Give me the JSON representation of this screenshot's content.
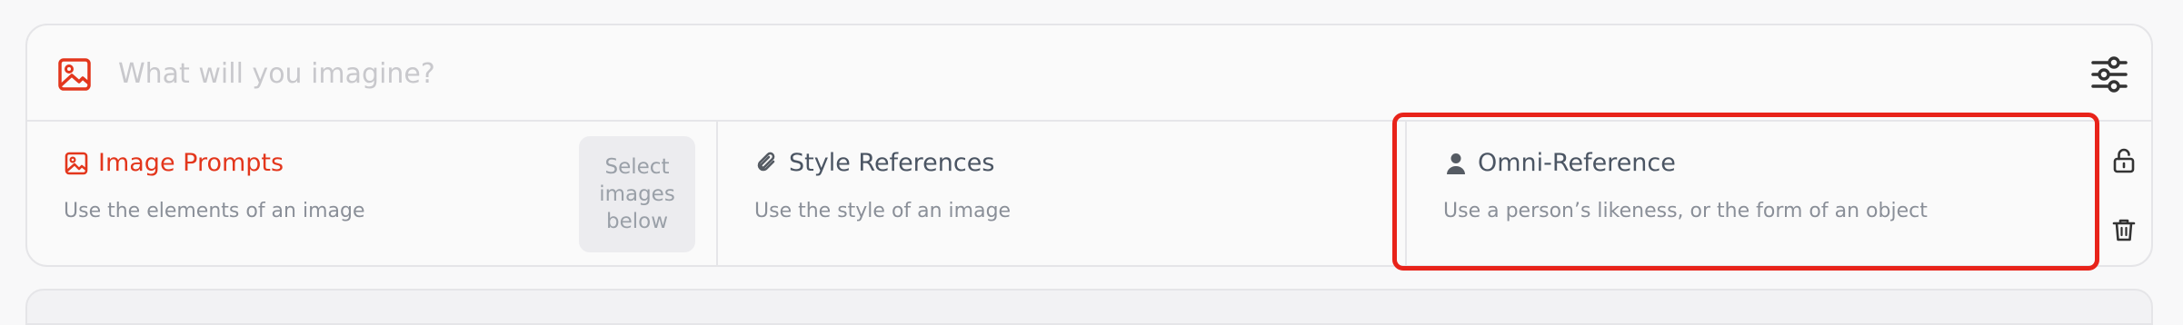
{
  "prompt": {
    "placeholder": "What will you imagine?",
    "value": ""
  },
  "references": [
    {
      "title": "Image Prompts",
      "description": "Use the elements of an image",
      "icon": "image-icon",
      "color": "#e3361c",
      "action_label": "Select\nimages\nbelow"
    },
    {
      "title": "Style References",
      "description": "Use the style of an image",
      "icon": "paperclip-icon"
    },
    {
      "title": "Omni-Reference",
      "description": "Use a person’s likeness, or the form of an object",
      "icon": "person-icon",
      "highlighted": true
    }
  ],
  "side_actions": [
    {
      "icon": "unlock-icon"
    },
    {
      "icon": "trash-icon"
    }
  ],
  "colors": {
    "accent": "#e3361c",
    "highlight": "#e8231a"
  }
}
